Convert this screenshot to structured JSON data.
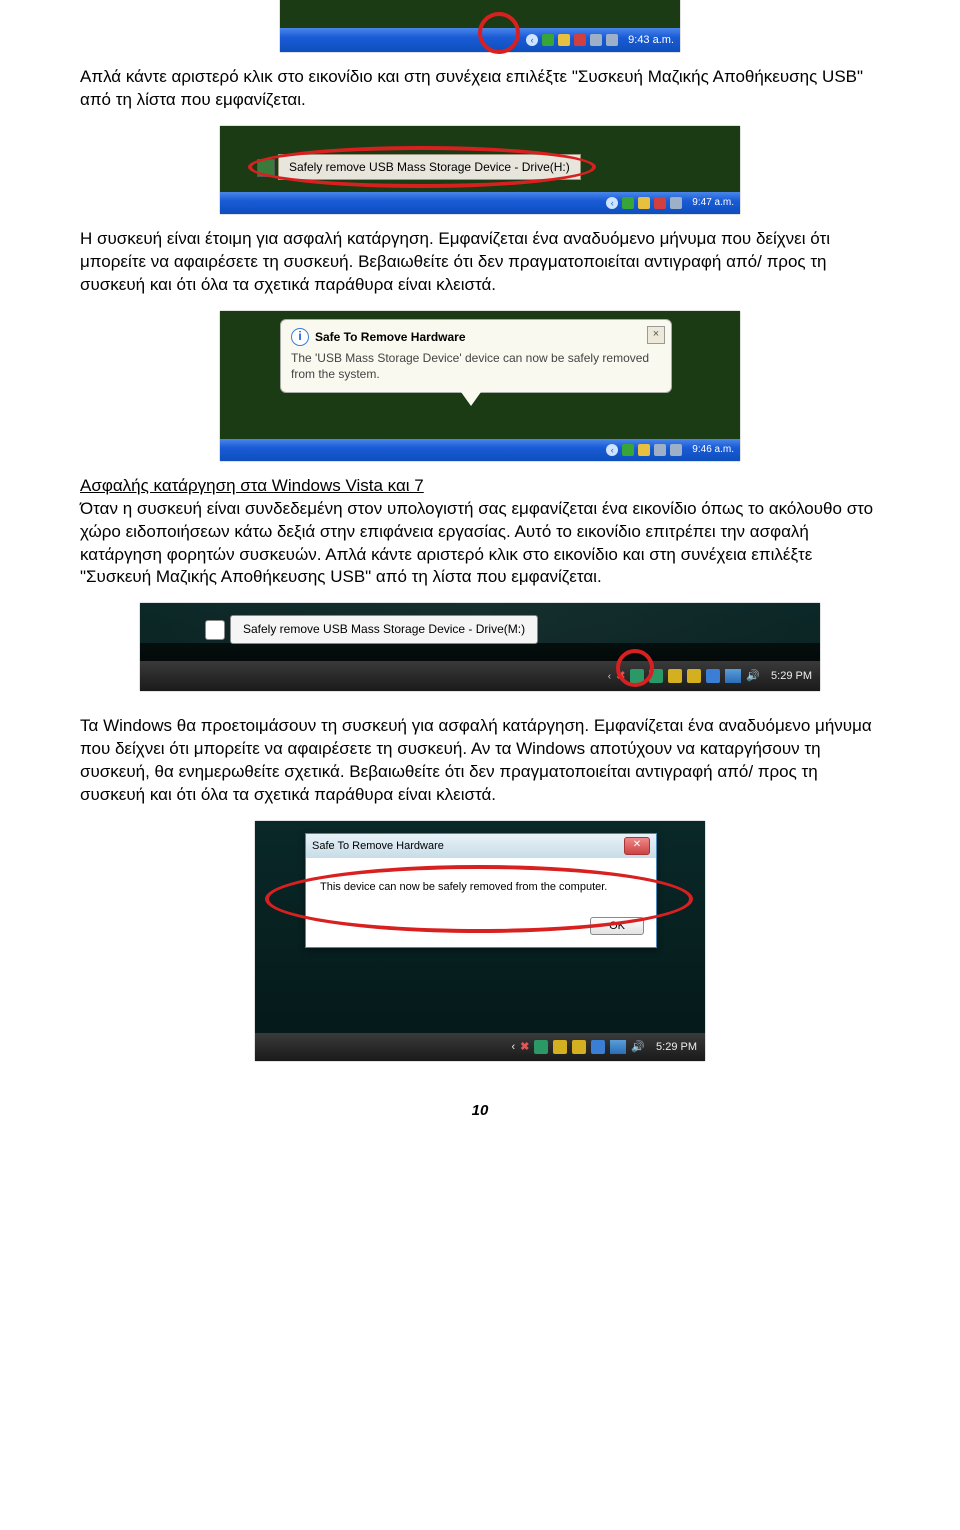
{
  "shot1": {
    "time": "9:43 a.m."
  },
  "para1": "Απλά κάντε αριστερό κλικ στο εικονίδιο και στη συνέχεια επιλέξτε \"Συσκευή Μαζικής Αποθήκευσης USB\" από τη λίστα που εμφανίζεται.",
  "shot2": {
    "menu_label": "Safely remove USB Mass Storage Device - Drive(H:)",
    "time": "9:47 a.m."
  },
  "para2": "Η συσκευή είναι έτοιμη για ασφαλή κατάργηση. Εμφανίζεται ένα αναδυόμενο μήνυμα που δείχνει ότι μπορείτε να αφαιρέσετε τη συσκευή. Βεβαιωθείτε ότι δεν πραγματοποιείται αντιγραφή από/ προς τη συσκευή και ότι όλα τα σχετικά παράθυρα είναι κλειστά.",
  "shot3": {
    "title": "Safe To Remove Hardware",
    "body": "The 'USB Mass Storage Device' device can now be safely removed from the system.",
    "time": "9:46 a.m."
  },
  "heading1": "Ασφαλής κατάργηση στα Windows Vista και 7",
  "para3": "Όταν η συσκευή είναι συνδεδεμένη στον υπολογιστή σας εμφανίζεται ένα εικονίδιο όπως το ακόλουθο στο χώρο ειδοποιήσεων κάτω δεξιά στην επιφάνεια εργασίας. Αυτό το εικονίδιο επιτρέπει την ασφαλή κατάργηση φορητών συσκευών. Απλά κάντε αριστερό κλικ στο εικονίδιο και στη συνέχεια επιλέξτε \"Συσκευή Μαζικής Αποθήκευσης USB\" από τη λίστα που εμφανίζεται.",
  "shot4": {
    "menu_label": "Safely remove USB Mass Storage Device - Drive(M:)",
    "time": "5:29 PM"
  },
  "para4": "Τα Windows θα προετοιμάσουν τη συσκευή για ασφαλή κατάργηση. Εμφανίζεται ένα αναδυόμενο μήνυμα που δείχνει ότι μπορείτε να αφαιρέσετε τη συσκευή. Αν τα Windows αποτύχουν να καταργήσουν τη συσκευή, θα ενημερωθείτε σχετικά. Βεβαιωθείτε ότι δεν πραγματοποιείται αντιγραφή από/ προς τη συσκευή και ότι όλα τα σχετικά παράθυρα είναι κλειστά.",
  "shot5": {
    "title": "Safe To Remove Hardware",
    "body": "This device can now be safely removed from the computer.",
    "ok": "OK",
    "time": "5:29 PM"
  },
  "page_number": "10"
}
